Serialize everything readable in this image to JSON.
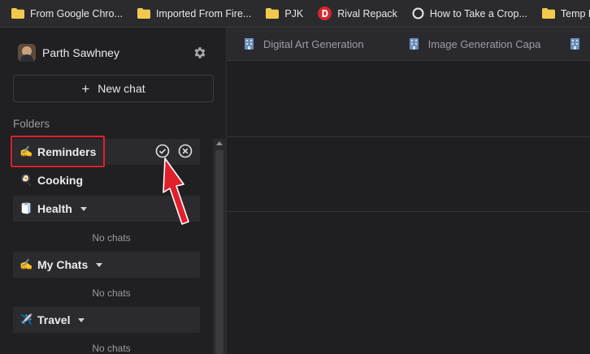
{
  "bookmarks": [
    {
      "label": "From Google Chro...",
      "icon": "folder-icon"
    },
    {
      "label": "Imported From Fire...",
      "icon": "folder-icon"
    },
    {
      "label": "PJK",
      "icon": "folder-icon"
    },
    {
      "label": "Rival Repack",
      "icon": "rival-repack-icon"
    },
    {
      "label": "How to Take a Crop...",
      "icon": "circle-icon"
    },
    {
      "label": "Temp Bookmarks",
      "icon": "folder-icon"
    }
  ],
  "user": {
    "name": "Parth Sawhney"
  },
  "sidebar": {
    "new_chat_label": "New chat",
    "folders_title": "Folders",
    "editing_folder_value": "Reminders",
    "editing_folder_emoji": "✍️",
    "cooking": {
      "emoji": "🍳",
      "label": "Cooking"
    },
    "folders": [
      {
        "emoji": "🧻",
        "label": "Health",
        "empty_text": "No chats"
      },
      {
        "emoji": "✍️",
        "label": "My Chats",
        "empty_text": "No chats"
      },
      {
        "emoji": "✈️",
        "label": "Travel",
        "empty_text": "No chats"
      }
    ]
  },
  "tabs": [
    {
      "label": "Digital Art Generation"
    },
    {
      "label": "Image Generation Capabilities"
    }
  ],
  "colors": {
    "highlight": "#e0202a",
    "folder": "#f2c94c"
  }
}
